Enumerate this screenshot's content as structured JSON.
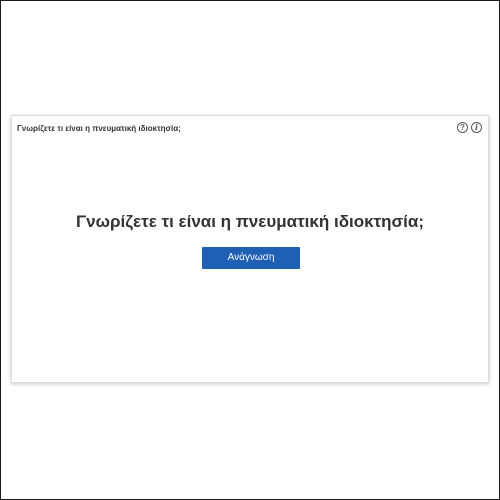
{
  "card": {
    "title": "Γνωρίζετε τι είναι η πνευματική ιδιοκτησία;",
    "help_icon_glyph": "?",
    "info_icon_glyph": "i"
  },
  "main": {
    "headline": "Γνωρίζετε τι είναι η πνευματική ιδιοκτησία;",
    "read_button_label": "Ανάγνωση"
  },
  "icons": {
    "help": "question-circle-icon",
    "info": "info-circle-icon"
  },
  "colors": {
    "button_background": "#1f5fb4",
    "button_text": "#ffffff",
    "headline_text": "#333333"
  }
}
